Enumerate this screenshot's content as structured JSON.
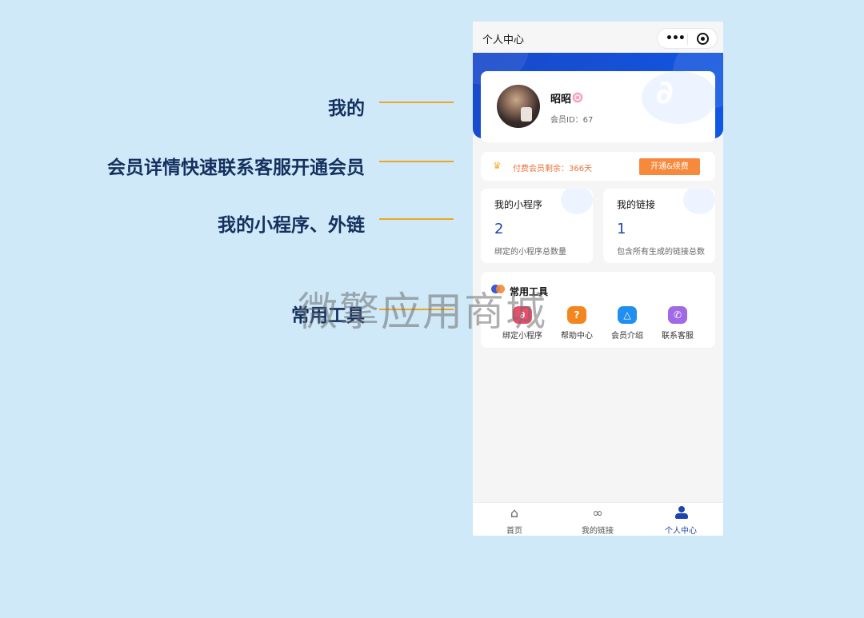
{
  "annotations": [
    "我的",
    "会员详情快速联系客服开通会员",
    "我的小程序、外链",
    "常用工具"
  ],
  "watermark": "微擎应用商城",
  "navbar": {
    "title": "个人中心",
    "capsule_more": "•••"
  },
  "profile": {
    "nickname": "昭昭",
    "member_id": "会员ID：67"
  },
  "vip": {
    "text": "付费会员剩余：366天",
    "button": "开通&续费"
  },
  "stats": [
    {
      "title": "我的小程序",
      "value": "2",
      "desc": "绑定的小程序总数量"
    },
    {
      "title": "我的链接",
      "value": "1",
      "desc": "包含所有生成的链接总数"
    }
  ],
  "tools": {
    "title": "常用工具",
    "items": [
      {
        "label": "绑定小程序",
        "glyph": "∂",
        "color": "#ef4b6b"
      },
      {
        "label": "帮助中心",
        "glyph": "?",
        "color": "#f4861f"
      },
      {
        "label": "会员介绍",
        "glyph": "△",
        "color": "#1f8ff0"
      },
      {
        "label": "联系客服",
        "glyph": "✆",
        "color": "#a06ae6"
      }
    ]
  },
  "tabbar": [
    {
      "label": "首页",
      "icon": "home-icon",
      "glyph": "⌂"
    },
    {
      "label": "我的链接",
      "icon": "link-icon",
      "glyph": "∞"
    },
    {
      "label": "个人中心",
      "icon": "person-icon",
      "glyph": ""
    }
  ],
  "colors": {
    "primary": "#1a49c9",
    "accent": "#f6893b",
    "annotation": "#14305e",
    "line": "#f0a522"
  }
}
